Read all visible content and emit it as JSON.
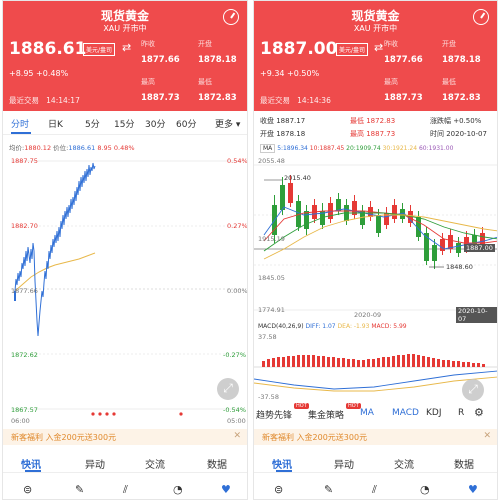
{
  "colors": {
    "header_bg": "#ef4b4c",
    "accent_blue": "#2f6fd6",
    "up_red": "#e53935",
    "down_green": "#2e9e3a",
    "avg_line": "#e8b84a"
  },
  "left": {
    "header": {
      "title": "现货黄金",
      "subtitle": "XAU 开市中",
      "price": "1886.61",
      "unit_tag": "美元/盎司",
      "change": "+8.95 +0.48%",
      "last_trade_label": "最近交易",
      "last_trade_time": "14:14:17",
      "prev_close_label": "昨收",
      "prev_close": "1877.66",
      "open_label": "开盘",
      "open": "1878.18",
      "high_label": "最高",
      "high": "1887.73",
      "low_label": "最低",
      "low": "1872.83"
    },
    "tabs": [
      "分时",
      "日K",
      "5分",
      "15分",
      "30分",
      "60分",
      "更多 ▾"
    ],
    "info": {
      "avg_label": "均价:",
      "avg": "1880.12",
      "price_label": "价位:",
      "price": "1886.61",
      "chg": "8.95",
      "pct": "0.48%"
    },
    "y_left": [
      "1887.75",
      "1882.70",
      "1877.66",
      "1872.62",
      "1867.57"
    ],
    "y_right": [
      "0.54%",
      "0.27%",
      "0.00%",
      "-0.27%",
      "-0.54%"
    ],
    "x_labels": [
      "06:00",
      "05:00"
    ],
    "banner": "新客福利 入金200元送300元",
    "bottom_tabs": [
      "快讯",
      "异动",
      "交流",
      "数据"
    ]
  },
  "right": {
    "header": {
      "title": "现货黄金",
      "subtitle": "XAU 开市中",
      "price": "1887.00",
      "unit_tag": "美元/盎司",
      "change": "+9.34 +0.50%",
      "last_trade_label": "最近交易",
      "last_trade_time": "14:14:36",
      "prev_close_label": "昨收",
      "prev_close": "1877.66",
      "open_label": "开盘",
      "open": "1878.18",
      "high_label": "最高",
      "high": "1887.73",
      "low_label": "最低",
      "low": "1872.83"
    },
    "stats": {
      "row1": [
        "收盘 1887.17",
        "最低 1872.83",
        "涨跌幅 +0.50%"
      ],
      "row2": [
        "开盘 1878.18",
        "最高 1887.73",
        "时间 2020-10-07"
      ]
    },
    "ma_line": {
      "tag": "MA",
      "ma5": "5:1896.34",
      "ma10": "10:1887.45",
      "ma20": "20:1909.74",
      "ma30": "30:1921.24",
      "ma60": "60:1931.00"
    },
    "y_labels": [
      "2055.48",
      "1915.19",
      "1845.05",
      "1774.91"
    ],
    "annot_high": "2015.40",
    "annot_low": "1848.60",
    "current_tag": "1887.00",
    "date_mid": "2020-09",
    "date_end": "2020-10-07",
    "macd_line": {
      "tag": "MACD(40,26,9)",
      "diff": "DIFF: 1.07",
      "dea": "DEA: -1.93",
      "macd": "MACD: 5.99"
    },
    "macd_top": "37.58",
    "macd_bottom": "-37.58",
    "ind_tabs": [
      "趋势先锋",
      "集金策略",
      "MA",
      "MACD",
      "KDJ",
      "R"
    ],
    "hot": "HOT",
    "banner": "新客福利 入金200元送300元",
    "bottom_tabs": [
      "快讯",
      "异动",
      "交流",
      "数据"
    ]
  }
}
